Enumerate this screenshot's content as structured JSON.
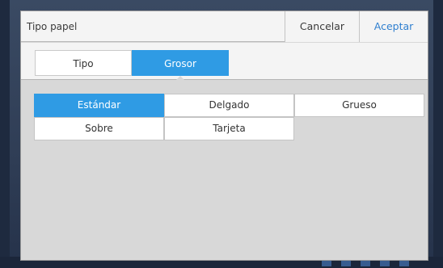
{
  "dialog": {
    "title": "Tipo papel",
    "cancel_label": "Cancelar",
    "accept_label": "Aceptar"
  },
  "tabs": [
    {
      "label": "Tipo",
      "selected": false
    },
    {
      "label": "Grosor",
      "selected": true
    }
  ],
  "thickness_options": [
    {
      "label": "Estándar",
      "selected": true
    },
    {
      "label": "Delgado",
      "selected": false
    },
    {
      "label": "Grueso",
      "selected": false
    },
    {
      "label": "Sobre",
      "selected": false
    },
    {
      "label": "Tarjeta",
      "selected": false
    }
  ],
  "colors": {
    "accent": "#2f9be4",
    "accept_text": "#2f7fcf"
  }
}
